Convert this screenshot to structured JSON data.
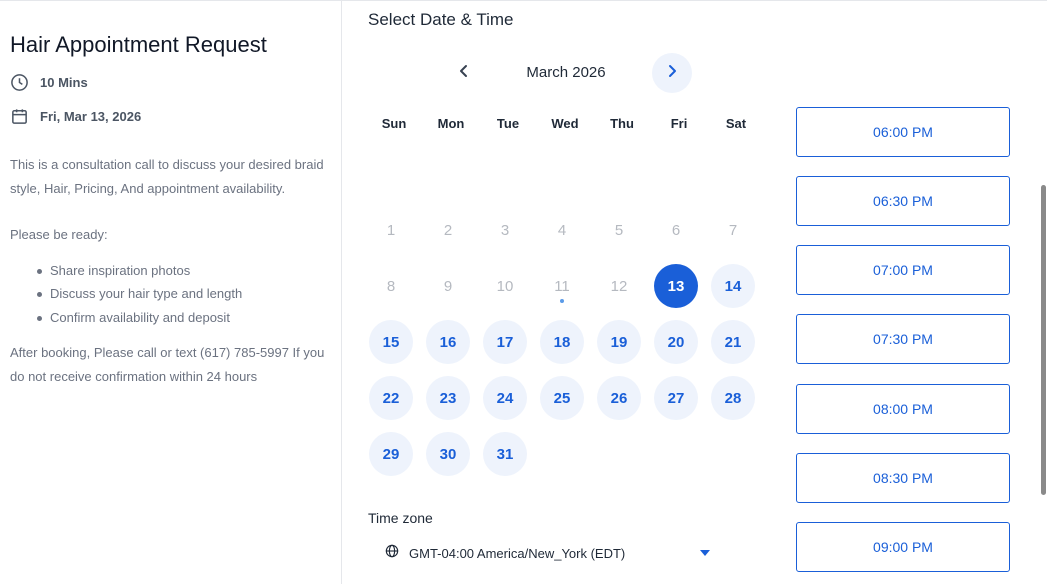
{
  "event": {
    "title": "Hair Appointment Request",
    "duration": "10 Mins",
    "date": "Fri, Mar 13, 2026",
    "description": {
      "intro": "This is a consultation call to discuss your desired braid style, Hair, Pricing, And appointment availability.",
      "ready_label": "Please be ready:",
      "bullets": [
        "Share inspiration photos",
        "Discuss your hair type and length",
        "Confirm availability and deposit"
      ],
      "outro": "After booking, Please call or text (617) 785-5997 If you do not receive confirmation within 24 hours"
    }
  },
  "scheduler": {
    "heading": "Select Date & Time",
    "month_label": "March 2026",
    "weekdays": [
      "Sun",
      "Mon",
      "Tue",
      "Wed",
      "Thu",
      "Fri",
      "Sat"
    ],
    "selected_day": "13",
    "days": [
      "1",
      "2",
      "3",
      "4",
      "5",
      "6",
      "7",
      "8",
      "9",
      "10",
      "11",
      "12",
      "13",
      "14",
      "15",
      "16",
      "17",
      "18",
      "19",
      "20",
      "21",
      "22",
      "23",
      "24",
      "25",
      "26",
      "27",
      "28",
      "29",
      "30",
      "31"
    ],
    "timezone_label": "Time zone",
    "timezone_value": "GMT-04:00 America/New_York (EDT)",
    "time_slots": [
      "06:00 PM",
      "06:30 PM",
      "07:00 PM",
      "07:30 PM",
      "08:00 PM",
      "08:30 PM",
      "09:00 PM"
    ]
  },
  "icons": {
    "duration": "clock-icon",
    "date": "calendar-icon",
    "prev": "chevron-left-icon",
    "next": "chevron-right-icon",
    "timezone": "globe-icon",
    "dropdown": "caret-down-icon"
  },
  "colors": {
    "accent": "#1a5fd8",
    "available_bg": "#eef3fc",
    "muted_text": "#6b7280",
    "past_text": "#b5b9c0"
  }
}
